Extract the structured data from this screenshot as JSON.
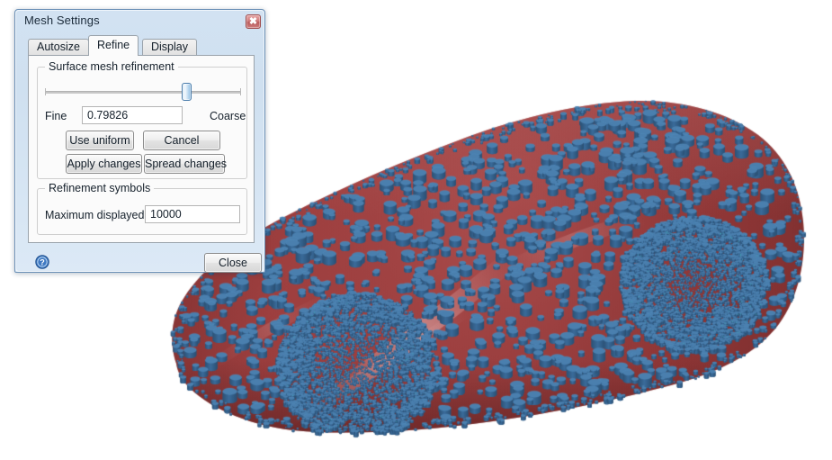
{
  "window": {
    "title": "Mesh Settings",
    "close_button_icon": "close-x-icon",
    "close_button_glyph": "✖"
  },
  "tabs": [
    {
      "label": "Autosize",
      "active": false
    },
    {
      "label": "Refine",
      "active": true
    },
    {
      "label": "Display",
      "active": false
    }
  ],
  "surface_group": {
    "title": "Surface mesh refinement",
    "slider": {
      "name": "refinement-slider",
      "value": 0.79826,
      "min": 0,
      "max": 1,
      "position_percent": 72,
      "min_label": "Fine",
      "max_label": "Coarse"
    },
    "value_field": {
      "value": "0.79826",
      "placeholder": ""
    },
    "buttons": [
      {
        "label": "Use uniform",
        "name": "use-uniform-button"
      },
      {
        "label": "Cancel",
        "name": "cancel-button"
      },
      {
        "label": "Apply changes",
        "name": "apply-changes-button"
      },
      {
        "label": "Spread changes",
        "name": "spread-changes-button"
      }
    ]
  },
  "symbols_group": {
    "title": "Refinement symbols",
    "max_displayed_label": "Maximum displayed",
    "max_displayed_value": "10000"
  },
  "footer": {
    "help_icon": "help-question-icon",
    "close_label": "Close"
  },
  "viewport": {
    "name": "3d-model-viewport",
    "model": "car-body-surface-mesh",
    "background_color": "#ffffff",
    "surface_color": "#9e3b3b",
    "surface_highlight_color": "#d9a0a0",
    "symbol_color": "#3a6b9a",
    "symbol_top_color": "#4a7fae",
    "symbol_shape": "cylinder"
  },
  "colors": {
    "dialog_frame": "#6b90b6",
    "dialog_background": "#d2e2f2",
    "panel_background": "#fbfbfb",
    "accent_blue": "#4a7cab",
    "close_red": "#b85a5a"
  }
}
